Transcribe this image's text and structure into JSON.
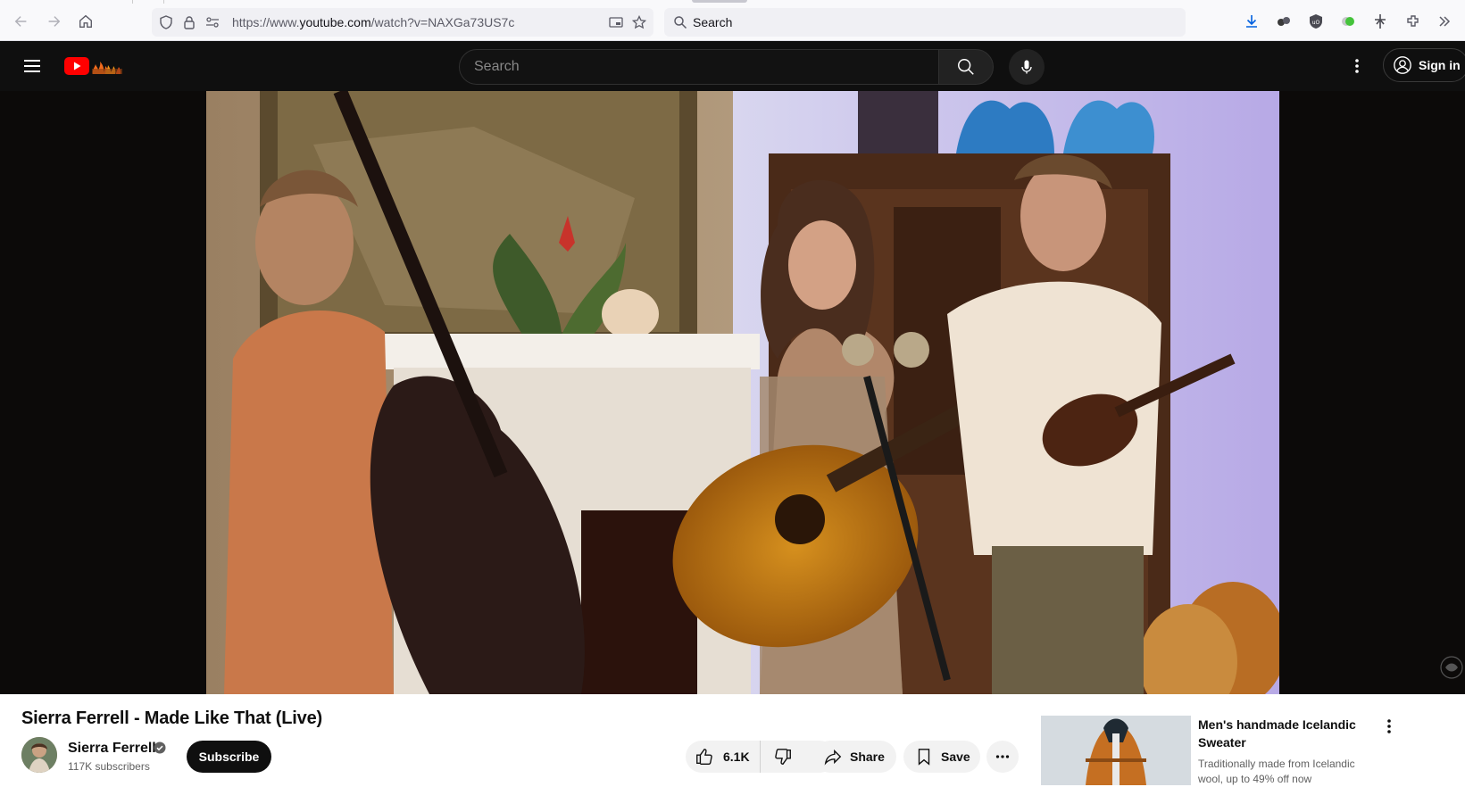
{
  "browser": {
    "url_prefix": "https://www.",
    "url_domain": "youtube.com",
    "url_path": "/watch?v=NAXGa73US7c",
    "search_label": "Search"
  },
  "youtube": {
    "search_placeholder": "Search",
    "signin_label": "Sign in"
  },
  "video": {
    "title": "Sierra Ferrell - Made Like That (Live)"
  },
  "channel": {
    "name": "Sierra Ferrell",
    "subscribers": "117K subscribers",
    "subscribe_label": "Subscribe"
  },
  "actions": {
    "likes": "6.1K",
    "share_label": "Share",
    "save_label": "Save"
  },
  "ad": {
    "title": "Men's handmade Icelandic Sweater",
    "description": "Traditionally made from Icelandic wool, up to 49% off now"
  },
  "colors": {
    "youtube_red": "#ff0000",
    "masthead_bg": "#0f0f0f",
    "subscribe_bg": "#0f0f0f",
    "pill_bg": "#f2f2f2"
  },
  "icons": [
    "back-icon",
    "forward-icon",
    "home-icon",
    "shield-icon",
    "lock-icon",
    "permissions-icon",
    "picture-in-picture-icon",
    "star-icon",
    "search-icon",
    "download-icon",
    "extension-icon",
    "ublock-icon",
    "menu-icon",
    "mic-icon",
    "kebab-icon",
    "account-icon",
    "verified-icon",
    "thumbs-up-icon",
    "thumbs-down-icon",
    "share-icon",
    "bookmark-icon",
    "more-icon"
  ]
}
